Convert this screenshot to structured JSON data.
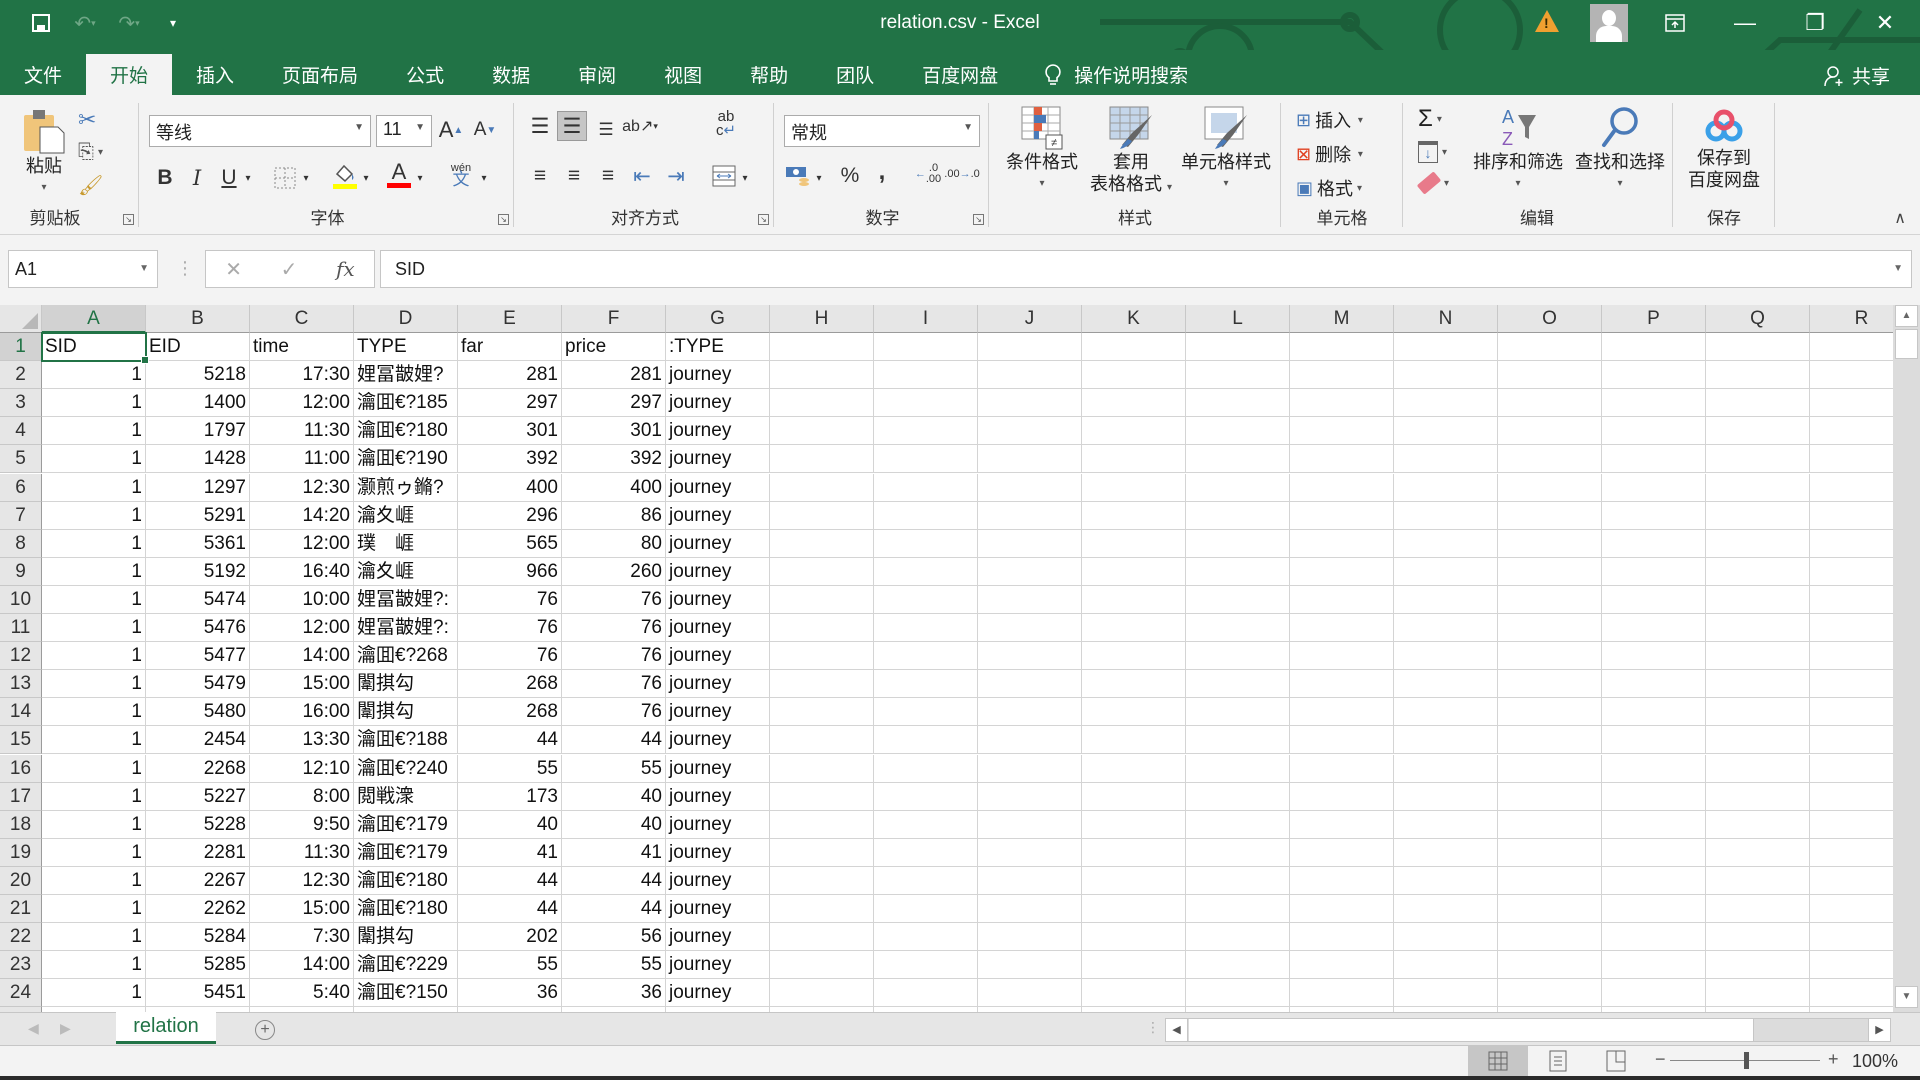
{
  "window": {
    "title": "relation.csv  -  Excel",
    "share_label": "共享",
    "tell_me": "操作说明搜索"
  },
  "menu_tabs": [
    "文件",
    "开始",
    "插入",
    "页面布局",
    "公式",
    "数据",
    "审阅",
    "视图",
    "帮助",
    "团队",
    "百度网盘"
  ],
  "active_tab": "开始",
  "ribbon": {
    "clipboard": {
      "label": "剪贴板",
      "paste": "粘贴"
    },
    "font": {
      "label": "字体",
      "font_name": "等线",
      "font_size": "11",
      "bold": "B",
      "italic": "I",
      "underline": "U",
      "phonetic_top": "wén",
      "phonetic_bottom": "文",
      "grow": "A",
      "shrink": "A"
    },
    "alignment": {
      "label": "对齐方式",
      "wrap_top": "ab",
      "wrap_bottom": "c"
    },
    "number": {
      "label": "数字",
      "format": "常规",
      "percent": "%",
      "comma": ",",
      "inc_dec": "←.0 .00",
      "dec_dec": ".00 →.0"
    },
    "styles": {
      "label": "样式",
      "conditional": "条件格式",
      "table_line1": "套用",
      "table_line2": "表格格式",
      "cell_styles": "单元格样式"
    },
    "cells": {
      "label": "单元格",
      "insert": "插入",
      "delete": "删除",
      "format": "格式"
    },
    "editing": {
      "label": "编辑",
      "sum": "Σ",
      "sort_filter": "排序和筛选",
      "find_select": "查找和选择"
    },
    "save": {
      "label": "保存",
      "line1": "保存到",
      "line2": "百度网盘"
    }
  },
  "formula_bar": {
    "name_box": "A1",
    "content": "SID",
    "cancel": "✕",
    "enter": "✓",
    "fx": "fx"
  },
  "columns": [
    "A",
    "B",
    "C",
    "D",
    "E",
    "F",
    "G",
    "H",
    "I",
    "J",
    "K",
    "L",
    "M",
    "N",
    "O",
    "P",
    "Q",
    "R"
  ],
  "selected_cell": "A1",
  "header_row": [
    "SID",
    "EID",
    "time",
    "TYPE",
    "far",
    "price",
    ":TYPE"
  ],
  "rows": [
    [
      "1",
      "5218",
      "17:30",
      "娌冨皵娌?",
      "281",
      "281",
      "journey"
    ],
    [
      "1",
      "1400",
      "12:00",
      "瀹囬€?185",
      "297",
      "297",
      "journey"
    ],
    [
      "1",
      "1797",
      "11:30",
      "瀹囬€?180",
      "301",
      "301",
      "journey"
    ],
    [
      "1",
      "1428",
      "11:00",
      "瀹囬€?190",
      "392",
      "392",
      "journey"
    ],
    [
      "1",
      "1297",
      "12:30",
      "灏煎ゥ鏅?",
      "400",
      "400",
      "journey"
    ],
    [
      "1",
      "5291",
      "14:20",
      "瀹夊崕",
      "296",
      "86",
      "journey"
    ],
    [
      "1",
      "5361",
      "12:00",
      "璞　崕",
      "565",
      "80",
      "journey"
    ],
    [
      "1",
      "5192",
      "16:40",
      "瀹夊崕",
      "966",
      "260",
      "journey"
    ],
    [
      "1",
      "5474",
      "10:00",
      "娌冨皵娌?:",
      "76",
      "76",
      "journey"
    ],
    [
      "1",
      "5476",
      "12:00",
      "娌冨皵娌?:",
      "76",
      "76",
      "journey"
    ],
    [
      "1",
      "5477",
      "14:00",
      "瀹囬€?268",
      "76",
      "76",
      "journey"
    ],
    [
      "1",
      "5479",
      "15:00",
      "闈掑勾",
      "268",
      "76",
      "journey"
    ],
    [
      "1",
      "5480",
      "16:00",
      "闈掑勾",
      "268",
      "76",
      "journey"
    ],
    [
      "1",
      "2454",
      "13:30",
      "瀹囬€?188",
      "44",
      "44",
      "journey"
    ],
    [
      "1",
      "2268",
      "12:10",
      "瀹囬€?240",
      "55",
      "55",
      "journey"
    ],
    [
      "1",
      "5227",
      "8:00",
      "閲戦潨",
      "173",
      "40",
      "journey"
    ],
    [
      "1",
      "5228",
      "9:50",
      "瀹囬€?179",
      "40",
      "40",
      "journey"
    ],
    [
      "1",
      "2281",
      "11:30",
      "瀹囬€?179",
      "41",
      "41",
      "journey"
    ],
    [
      "1",
      "2267",
      "12:30",
      "瀹囬€?180",
      "44",
      "44",
      "journey"
    ],
    [
      "1",
      "2262",
      "15:00",
      "瀹囬€?180",
      "44",
      "44",
      "journey"
    ],
    [
      "1",
      "5284",
      "7:30",
      "闈掑勾",
      "202",
      "56",
      "journey"
    ],
    [
      "1",
      "5285",
      "14:00",
      "瀹囬€?229",
      "55",
      "55",
      "journey"
    ],
    [
      "1",
      "5451",
      "5:40",
      "瀹囬€?150",
      "36",
      "36",
      "journey"
    ]
  ],
  "numeric_columns": [
    0,
    1,
    2,
    4,
    5
  ],
  "sheet_tabs": [
    "relation"
  ],
  "active_sheet": "relation",
  "status_bar": {
    "zoom": "100%",
    "zoom_minus": "−",
    "zoom_plus": "+"
  },
  "colors": {
    "brand": "#217346",
    "ribbon_bg": "#f3f3f3",
    "header_bg": "#e6e6e6"
  }
}
